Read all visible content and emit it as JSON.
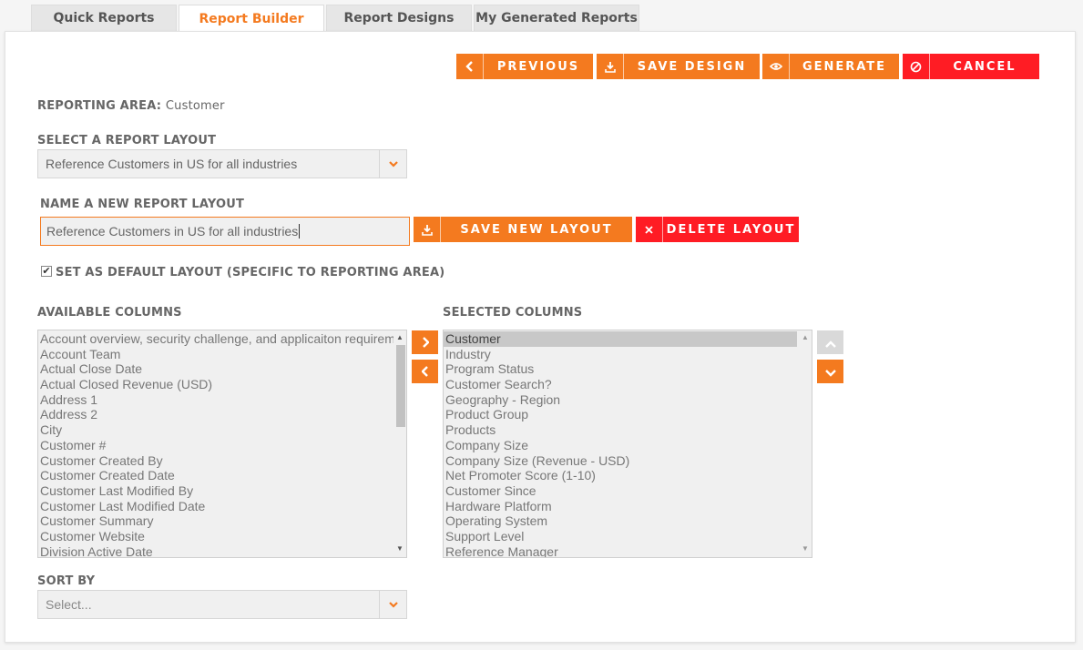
{
  "tabs": [
    "Quick Reports",
    "Report Builder",
    "Report Designs",
    "My Generated Reports"
  ],
  "toolbar": {
    "previous": "PREVIOUS",
    "save_design": "SAVE DESIGN",
    "generate": "GENERATE",
    "cancel": "CANCEL"
  },
  "reporting_area": {
    "label": "REPORTING AREA:",
    "value": "Customer"
  },
  "select_layout": {
    "label": "SELECT A REPORT LAYOUT",
    "value": "Reference Customers in US for all industries"
  },
  "new_layout": {
    "label": "NAME A NEW REPORT LAYOUT",
    "value": "Reference Customers in US for all industries",
    "save": "SAVE NEW LAYOUT",
    "delete": "DELETE LAYOUT"
  },
  "default_layout": {
    "label": "SET AS DEFAULT LAYOUT (SPECIFIC TO REPORTING AREA)",
    "checked": true
  },
  "available": {
    "label": "AVAILABLE COLUMNS",
    "items": [
      "Account overview, security challenge, and applicaiton requirements",
      "Account Team",
      "Actual Close Date",
      "Actual Closed Revenue (USD)",
      "Address 1",
      "Address 2",
      "City",
      "Customer #",
      "Customer Created By",
      "Customer Created Date",
      "Customer Last Modified By",
      "Customer Last Modified Date",
      "Customer Summary",
      "Customer Website",
      "Division Active Date"
    ]
  },
  "selected": {
    "label": "SELECTED COLUMNS",
    "items": [
      "Customer",
      "Industry",
      "Program Status",
      "Customer Search?",
      "Geography - Region",
      "Product Group",
      "Products",
      "Company Size",
      "Company Size (Revenue - USD)",
      "Net Promoter Score (1-10)",
      "Customer Since",
      "Hardware Platform",
      "Operating System",
      "Support Level",
      "Reference Manager"
    ]
  },
  "sort_by": {
    "label": "SORT BY",
    "placeholder": "Select..."
  },
  "colors": {
    "accent": "#f47a1f",
    "danger": "#ff1c24"
  },
  "icons": [
    "chevron-left-icon",
    "download-icon",
    "eye-icon",
    "no-entry-icon",
    "chevron-down-icon",
    "close-icon",
    "chevron-right-icon",
    "chevron-up-icon",
    "checkbox-checked-icon"
  ]
}
